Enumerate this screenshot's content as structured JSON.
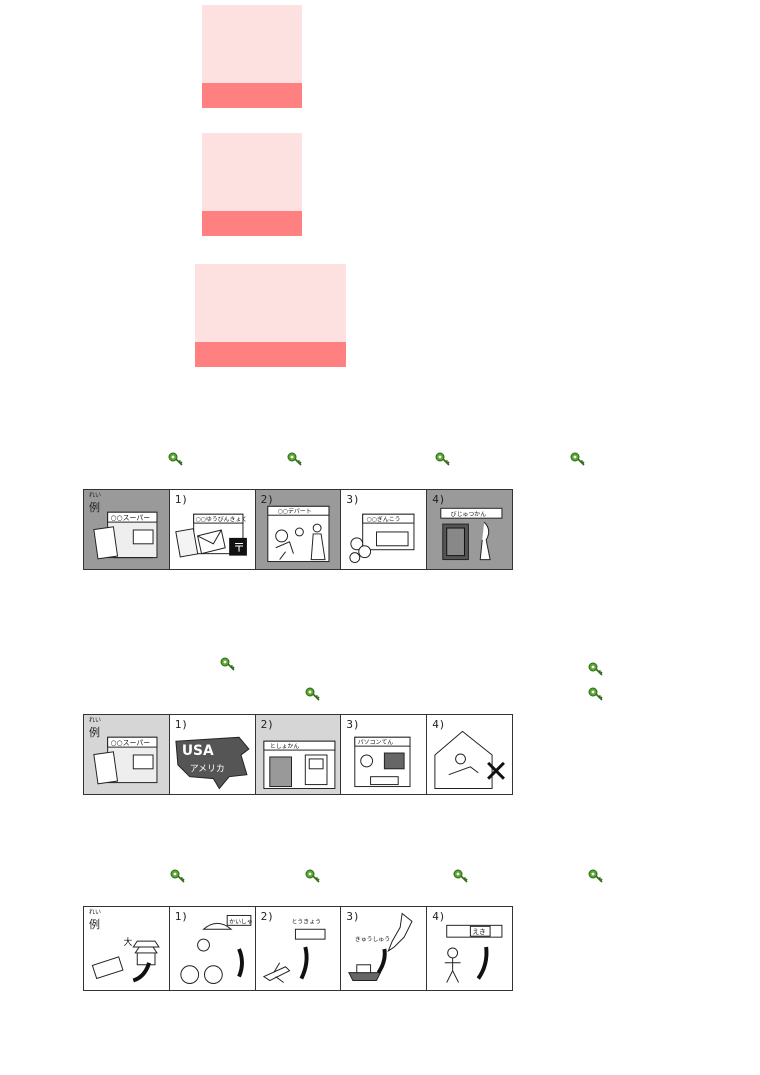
{
  "strips": [
    {
      "panels": [
        {
          "label": "例",
          "ruby": "れい",
          "text": "○○スーパー"
        },
        {
          "label": "1)",
          "text": "○○ゆうびんきょく"
        },
        {
          "label": "2)",
          "text": "○○デパート"
        },
        {
          "label": "3)",
          "text": "○○ぎんこう"
        },
        {
          "label": "4)",
          "text": "びじゅつかん"
        }
      ]
    },
    {
      "panels": [
        {
          "label": "例",
          "ruby": "れい",
          "text": "○○スーパー"
        },
        {
          "label": "1)",
          "text": "USA",
          "subtext": "アメリカ"
        },
        {
          "label": "2)",
          "text": "としょかん"
        },
        {
          "label": "3)",
          "text": "パソコンてん"
        },
        {
          "label": "4)",
          "text": ""
        }
      ]
    },
    {
      "panels": [
        {
          "label": "例",
          "ruby": "れい",
          "text": "大"
        },
        {
          "label": "1)",
          "text": "かいしゃ"
        },
        {
          "label": "2)",
          "text": "とうきょう"
        },
        {
          "label": "3)",
          "text": "きゅうしゅう"
        },
        {
          "label": "4)",
          "text": "えき"
        }
      ]
    }
  ],
  "icons": {
    "key": "key-icon"
  },
  "colors": {
    "card_fill": "#fde0e0",
    "card_bar": "#ff8080",
    "key_green": "#4c9a2a"
  }
}
